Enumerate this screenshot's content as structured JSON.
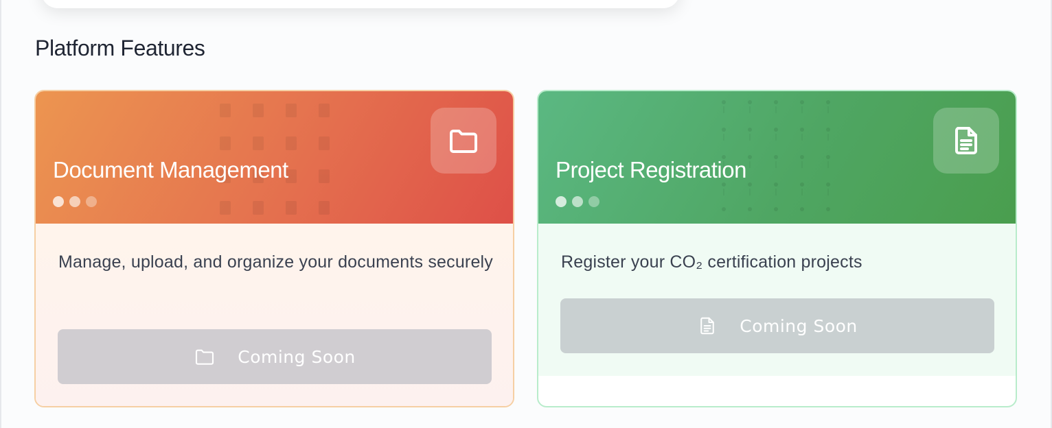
{
  "section": {
    "title": "Platform Features"
  },
  "cards": [
    {
      "id": "document-management",
      "title": "Document Management",
      "description": "Manage, upload, and organize your documents securely",
      "button_label": "Coming Soon",
      "icon": "folder-icon",
      "accent": "#e5744f",
      "border": "#f6cfa3"
    },
    {
      "id": "project-registration",
      "title": "Project Registration",
      "description": "Register your CO₂ certification projects",
      "button_label": "Coming Soon",
      "icon": "document-icon",
      "accent": "#4fa663",
      "border": "#b8eccb"
    }
  ]
}
